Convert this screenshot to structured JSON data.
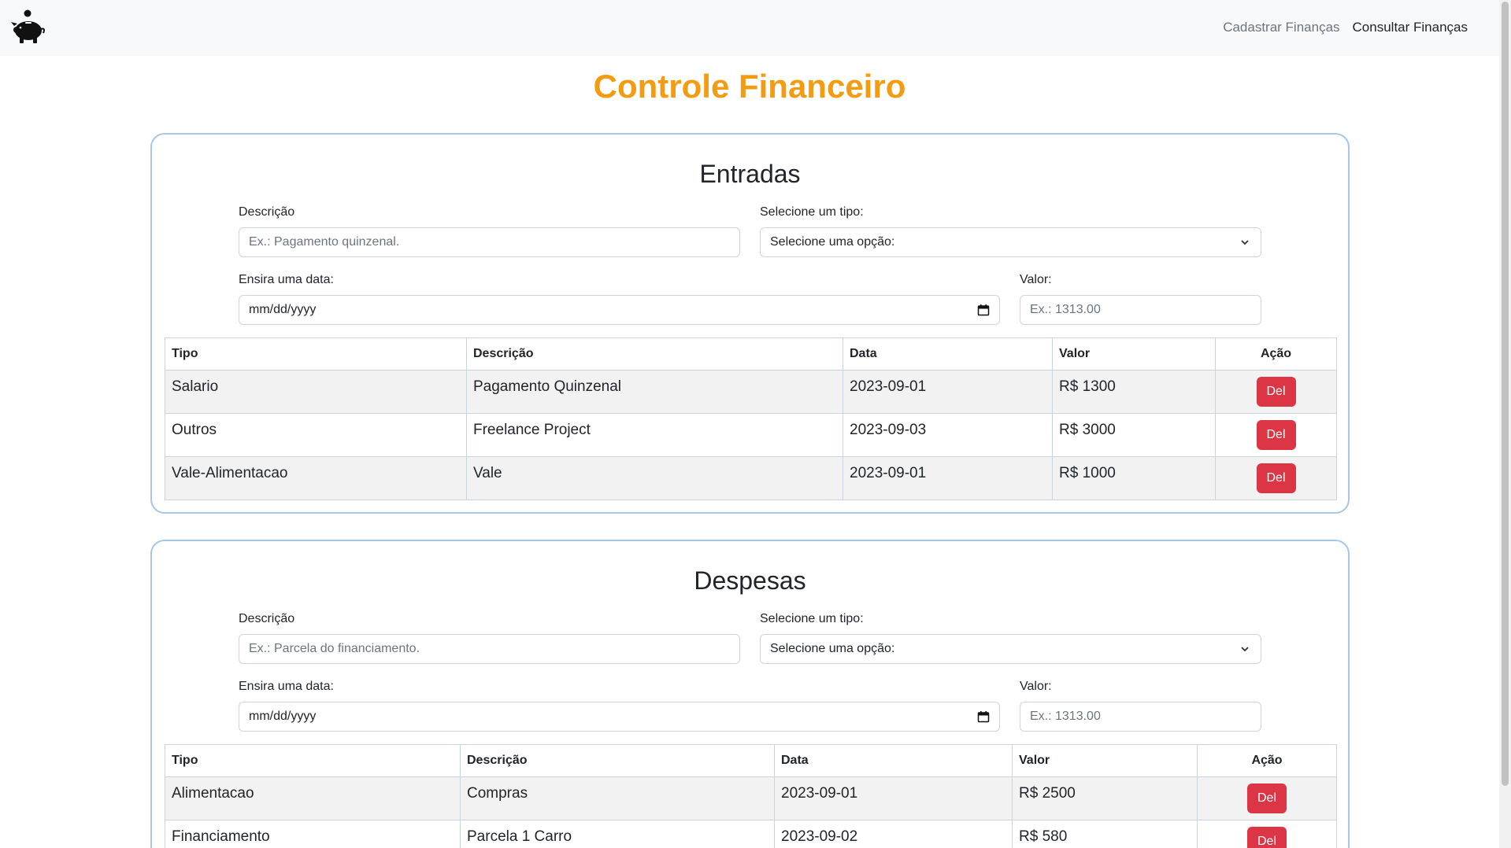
{
  "nav": {
    "logo_icon": "piggy-bank-icon",
    "links": [
      "Cadastrar Finanças",
      "Consultar Finanças"
    ]
  },
  "page_title": "Controle Financeiro",
  "colors": {
    "title": "#f39c12",
    "delete_button": "#dc3545",
    "card_border": "#a7c7e7"
  },
  "entradas": {
    "title": "Entradas",
    "descricao_label": "Descrição",
    "descricao_placeholder": "Ex.: Pagamento quinzenal.",
    "tipo_label": "Selecione um tipo:",
    "tipo_selected": "Selecione uma opção:",
    "data_label": "Ensira uma data:",
    "data_value": "mm/dd/yyyy",
    "valor_label": "Valor:",
    "valor_placeholder": "Ex.: 1313.00",
    "columns": [
      "Tipo",
      "Descrição",
      "Data",
      "Valor",
      "Ação"
    ],
    "rows": [
      {
        "tipo": "Salario",
        "descricao": "Pagamento Quinzenal",
        "data": "2023-09-01",
        "valor": "R$ 1300",
        "acao": "Del"
      },
      {
        "tipo": "Outros",
        "descricao": "Freelance Project",
        "data": "2023-09-03",
        "valor": "R$ 3000",
        "acao": "Del"
      },
      {
        "tipo": "Vale-Alimentacao",
        "descricao": "Vale",
        "data": "2023-09-01",
        "valor": "R$ 1000",
        "acao": "Del"
      }
    ]
  },
  "despesas": {
    "title": "Despesas",
    "descricao_label": "Descrição",
    "descricao_placeholder": "Ex.: Parcela do financiamento.",
    "tipo_label": "Selecione um tipo:",
    "tipo_selected": "Selecione uma opção:",
    "data_label": "Ensira uma data:",
    "data_value": "mm/dd/yyyy",
    "valor_label": "Valor:",
    "valor_placeholder": "Ex.: 1313.00",
    "columns": [
      "Tipo",
      "Descrição",
      "Data",
      "Valor",
      "Ação"
    ],
    "rows": [
      {
        "tipo": "Alimentacao",
        "descricao": "Compras",
        "data": "2023-09-01",
        "valor": "R$ 2500",
        "acao": "Del"
      },
      {
        "tipo": "Financiamento",
        "descricao": "Parcela 1 Carro",
        "data": "2023-09-02",
        "valor": "R$ 580",
        "acao": "Del"
      }
    ]
  }
}
